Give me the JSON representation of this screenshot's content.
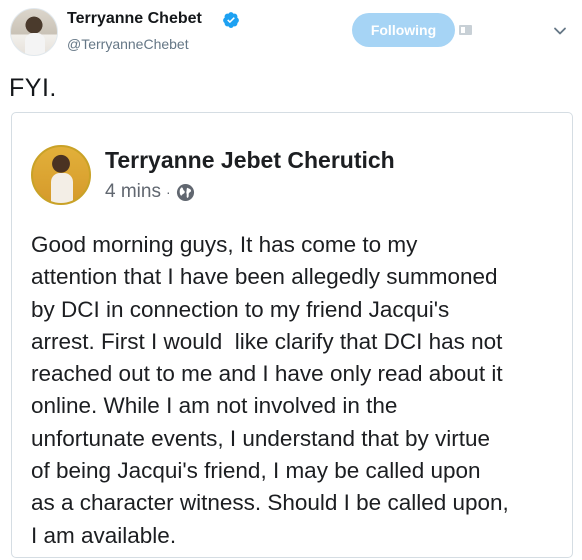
{
  "tweet": {
    "author": {
      "display_name": "Terryanne Chebet",
      "handle": "@TerryanneChebet",
      "verified": true
    },
    "follow_button_label": "Following",
    "text": "FYI."
  },
  "embedded_post": {
    "author_name": "Terryanne Jebet Cherutich",
    "timestamp": "4 mins",
    "separator": "·",
    "privacy_icon": "globe-icon",
    "body_lines": [
      "Good morning guys, It has come to my",
      "attention that I have been allegedly summoned",
      "by DCI in connection to my friend Jacqui's",
      "arrest. First I would  like clarify that DCI has not",
      "reached out to me and I have only read about it",
      "online. While I am not involved in the",
      "unfortunate events, I understand that by virtue",
      "of being Jacqui's friend, I may be called upon",
      "as a character witness. Should I be called upon,",
      "I am available."
    ]
  },
  "colors": {
    "verified_blue": "#1da1f2",
    "following_button_bg": "#a6d4f5",
    "handle_gray": "#657786",
    "card_border": "#d5dde3"
  }
}
